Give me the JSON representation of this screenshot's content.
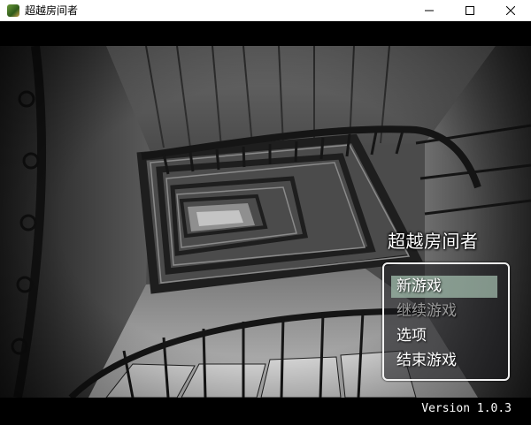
{
  "window": {
    "title": "超越房间者",
    "icon": "game-app-icon",
    "controls": [
      "minimize-icon",
      "maximize-icon",
      "close-icon"
    ]
  },
  "game": {
    "title": "超越房间者",
    "menu": [
      {
        "label": "新游戏",
        "state": "selected"
      },
      {
        "label": "继续游戏",
        "state": "disabled"
      },
      {
        "label": "选项",
        "state": "normal"
      },
      {
        "label": "结束游戏",
        "state": "normal"
      }
    ],
    "version": "Version 1.0.3"
  },
  "colors": {
    "selection": "#9db4a6",
    "disabled_text": "#9a9a9a",
    "menu_border": "#f2f2f2"
  }
}
